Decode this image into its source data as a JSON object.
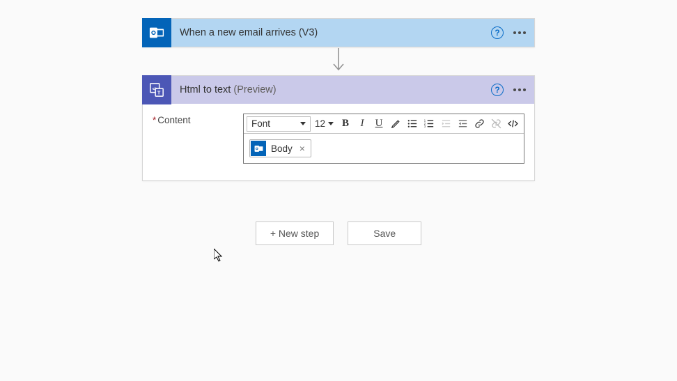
{
  "trigger": {
    "title": "When a new email arrives (V3)"
  },
  "action": {
    "title_main": "Html to text",
    "title_suffix": "(Preview)",
    "field_label": "Content",
    "token_label": "Body",
    "toolbar": {
      "font_label": "Font",
      "font_size": "12"
    }
  },
  "buttons": {
    "new_step": "+ New step",
    "save": "Save"
  }
}
